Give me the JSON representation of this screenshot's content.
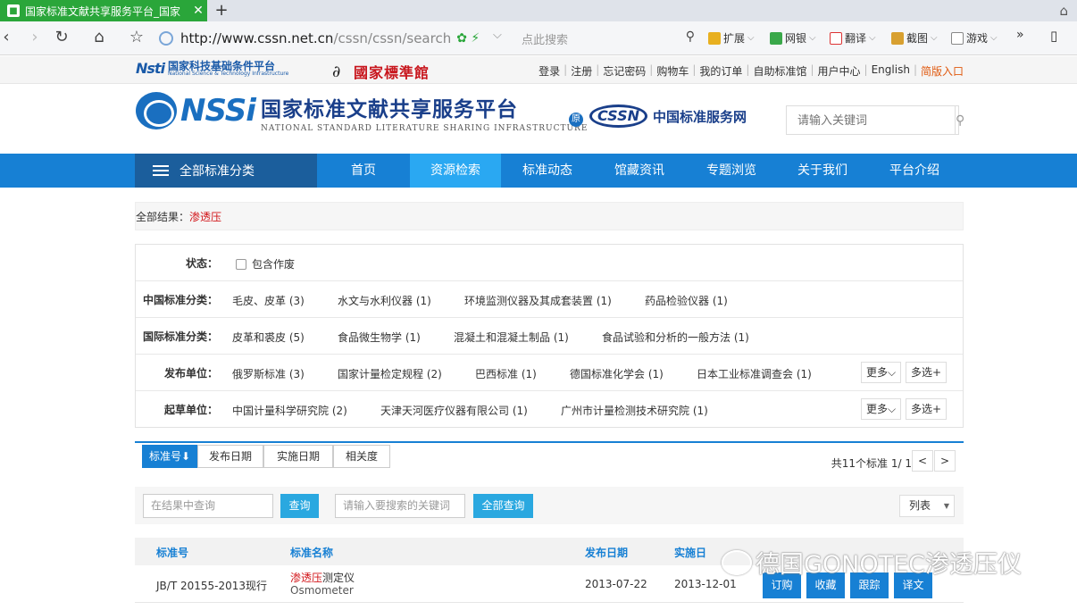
{
  "browser": {
    "tab_title": "国家标准文献共享服务平台_国家",
    "new_tab": "+",
    "url_host": "http://www.cssn.net.cn",
    "url_path": "/cssn/cssn/search",
    "search_placeholder": "点此搜索",
    "extensions": [
      "扩展",
      "网银",
      "翻译",
      "截图",
      "游戏"
    ],
    "more": "»"
  },
  "site_top": {
    "nstl_cn": "国家科技基础条件平台",
    "nstl_en": "National Science & Technology Infrastructure",
    "nlc": "國家標準館",
    "links": [
      "登录",
      "注册",
      "忘记密码",
      "购物车",
      "我的订单",
      "自助标准馆",
      "用户中心",
      "English",
      "简版入口"
    ]
  },
  "header": {
    "nssi": "NSSi",
    "title_cn": "国家标准文献共享服务平台",
    "title_en": "NATIONAL STANDARD LITERATURE SHARING INFRASTRUCTURE",
    "yuan": "原",
    "cssn": "CSSN",
    "cssn_cn": "中国标准服务网",
    "search_placeholder": "请输入关键词"
  },
  "nav": {
    "all_categories": "全部标准分类",
    "items": [
      "首页",
      "资源检索",
      "标准动态",
      "馆藏资讯",
      "专题浏览",
      "关于我们",
      "平台介绍"
    ],
    "active_index": 1
  },
  "breadcrumb": {
    "prefix": "全部结果：",
    "keyword": "渗透压"
  },
  "filters": {
    "status_label": "状态：",
    "status_option": "包含作废",
    "cn_label": "中国标准分类：",
    "cn_options": [
      "毛皮、皮革 (3)",
      "水文与水利仪器 (1)",
      "环境监测仪器及其成套装置 (1)",
      "药品检验仪器 (1)"
    ],
    "intl_label": "国际标准分类：",
    "intl_options": [
      "皮革和裘皮 (5)",
      "食品微生物学 (1)",
      "混凝土和混凝土制品 (1)",
      "食品试验和分析的一般方法 (1)"
    ],
    "pub_label": "发布单位：",
    "pub_options": [
      "俄罗斯标准 (3)",
      "国家计量检定规程 (2)",
      "巴西标准 (1)",
      "德国标准化学会 (1)",
      "日本工业标准调查会 (1)"
    ],
    "draft_label": "起草单位：",
    "draft_options": [
      "中国计量科学研究院 (2)",
      "天津天河医疗仪器有限公司 (1)",
      "广州市计量检测技术研究院 (1)"
    ],
    "more": "更多",
    "multi": "多选"
  },
  "sort": {
    "tabs": [
      "标准号⬇",
      "发布日期",
      "实施日期",
      "相关度"
    ],
    "total_text": "共11个标准 1/ 1",
    "prev": "<",
    "next": ">"
  },
  "query": {
    "within_placeholder": "在结果中查询",
    "query_btn": "查询",
    "keyword_placeholder": "请输入要搜索的关键词",
    "all_btn": "全部查询",
    "view_select": "列表"
  },
  "table": {
    "headers": [
      "标准号",
      "标准名称",
      "发布日期",
      "实施日"
    ],
    "rows": [
      {
        "code": "JB/T 20155-2013现行",
        "name_kw": "渗透压",
        "name_rest": "测定仪",
        "name_en": "Osmometer",
        "pub_date": "2013-07-22",
        "impl_date": "2013-12-01",
        "actions": [
          "订购",
          "收藏",
          "跟踪",
          "译文"
        ]
      }
    ]
  },
  "watermark": "德国GONOTEC渗透压仪",
  "colors": {
    "nav_blue": "#1780d4",
    "nav_active": "#2aa8f2",
    "keyword_red": "#d2161a",
    "tab_green": "#2aa63a"
  }
}
